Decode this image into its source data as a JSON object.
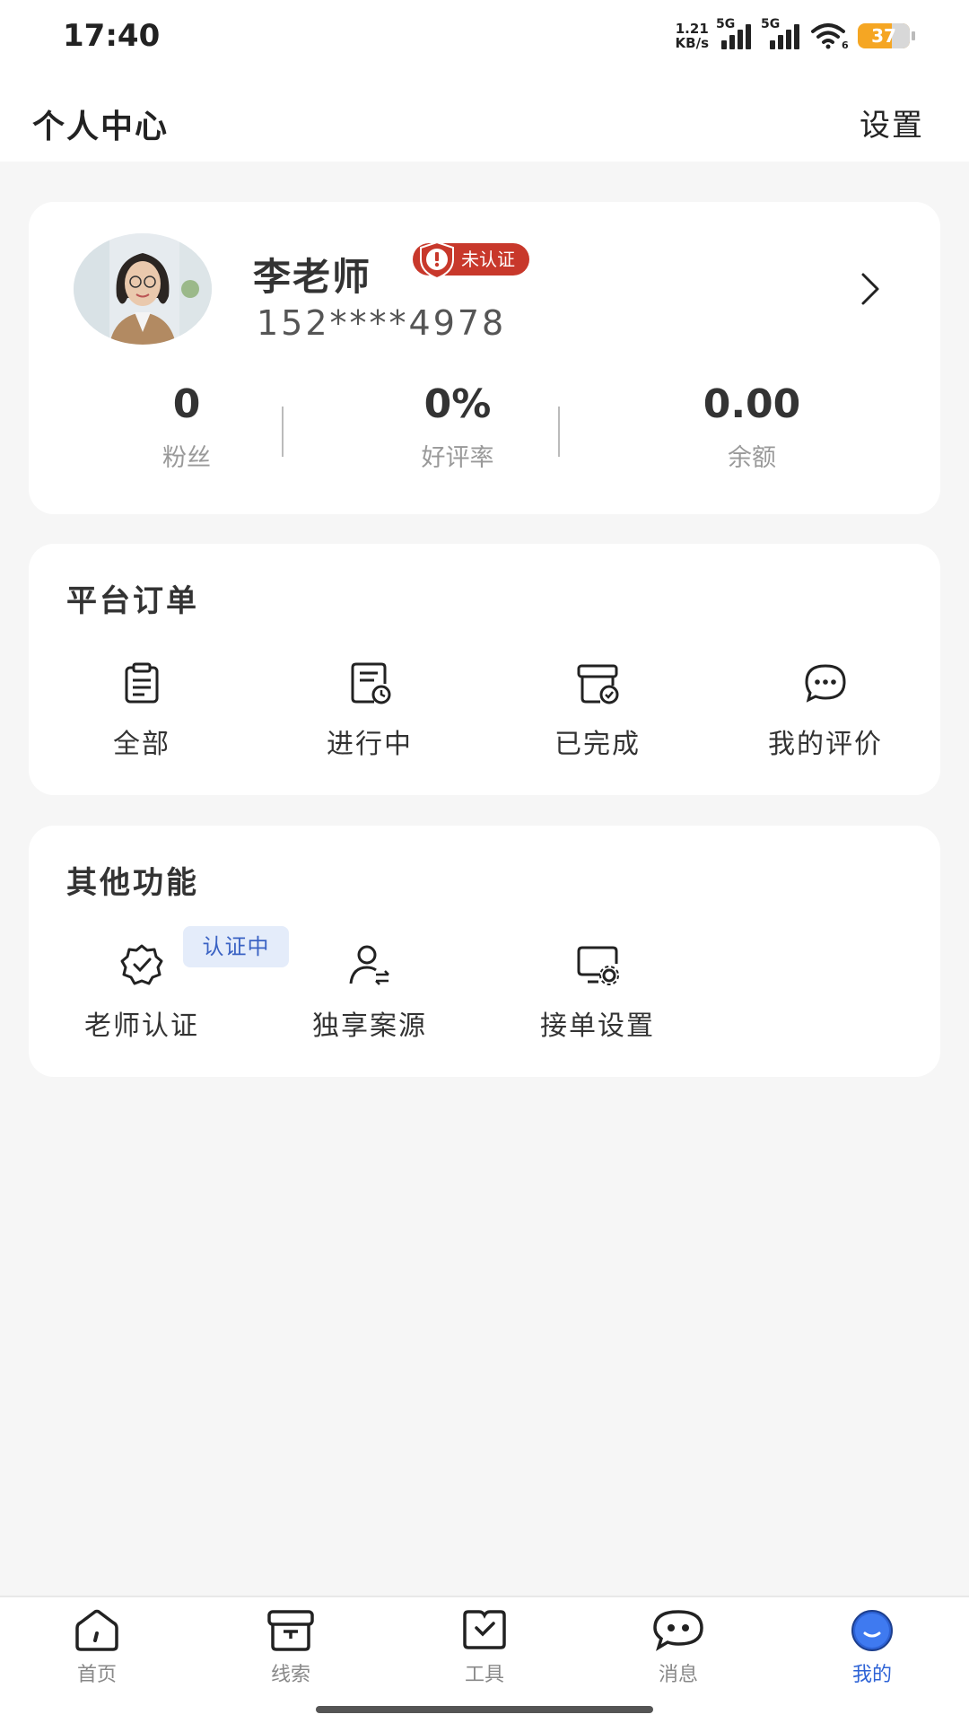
{
  "status_bar": {
    "time": "17:40",
    "net_speed_value": "1.21",
    "net_speed_unit": "KB/s",
    "sim1": "5G",
    "sim2": "5G",
    "wifi_sub": "6",
    "battery": "37",
    "battery_level": 0.37,
    "battery_color": "#f5a623"
  },
  "header": {
    "title": "个人中心",
    "settings": "设置"
  },
  "profile": {
    "name": "李老师",
    "badge": "未认证",
    "badge_color": "#c8382b",
    "phone": "152****4978",
    "avatar_icon": "avatar-photo",
    "arrow_icon": "chevron-right-icon"
  },
  "stats": [
    {
      "value": "0",
      "label": "粉丝"
    },
    {
      "value": "0%",
      "label": "好评率"
    },
    {
      "value": "0.00",
      "label": "余额"
    }
  ],
  "orders": {
    "title": "平台订单",
    "items": [
      {
        "label": "全部",
        "icon": "clipboard-icon"
      },
      {
        "label": "进行中",
        "icon": "document-clock-icon"
      },
      {
        "label": "已完成",
        "icon": "box-check-icon"
      },
      {
        "label": "我的评价",
        "icon": "chat-bubble-icon"
      }
    ]
  },
  "others": {
    "title": "其他功能",
    "items": [
      {
        "label": "老师认证",
        "icon": "verified-badge-icon",
        "tag": "认证中"
      },
      {
        "label": "独享案源",
        "icon": "user-transfer-icon"
      },
      {
        "label": "接单设置",
        "icon": "monitor-gear-icon"
      }
    ]
  },
  "tabbar": {
    "active_color": "#2e63d6",
    "items": [
      {
        "label": "首页",
        "icon": "home-icon"
      },
      {
        "label": "线索",
        "icon": "box-icon"
      },
      {
        "label": "工具",
        "icon": "tool-book-icon"
      },
      {
        "label": "消息",
        "icon": "message-icon"
      },
      {
        "label": "我的",
        "icon": "profile-smile-icon"
      }
    ]
  }
}
